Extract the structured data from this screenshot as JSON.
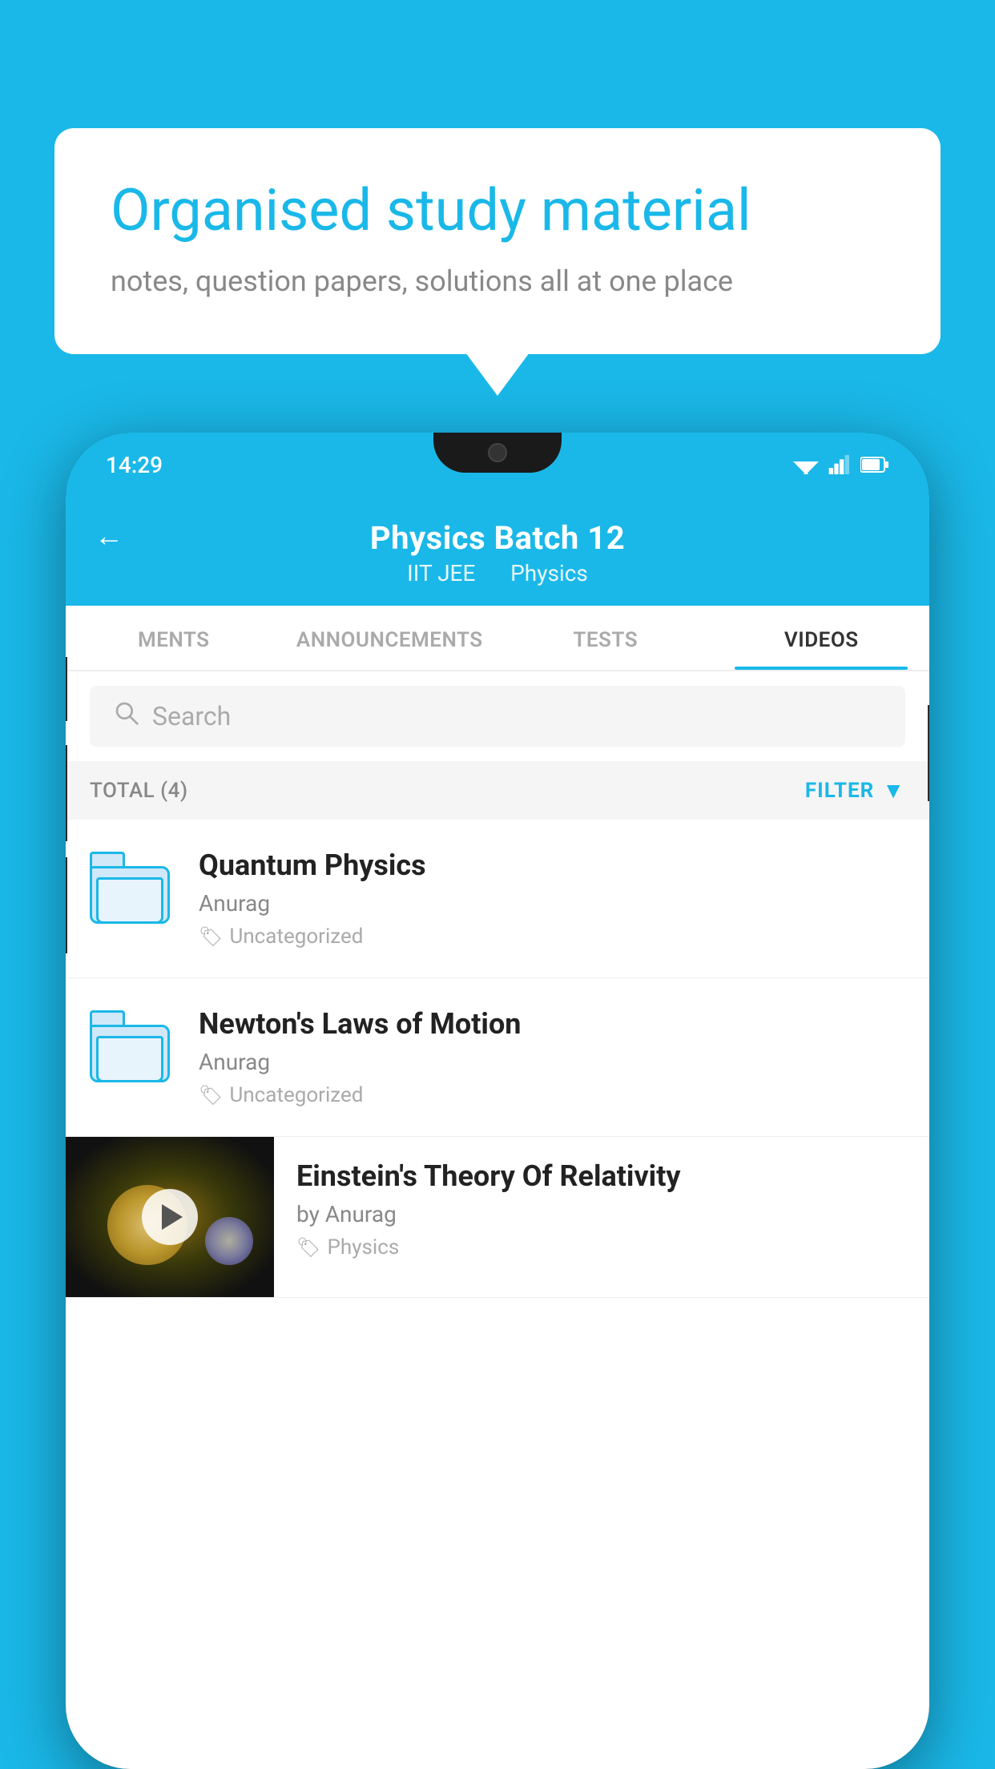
{
  "background_color": "#1ab8e8",
  "bubble": {
    "title": "Organised study material",
    "subtitle": "notes, question papers, solutions all at one place"
  },
  "phone": {
    "status_bar": {
      "time": "14:29"
    },
    "header": {
      "title": "Physics Batch 12",
      "tag1": "IIT JEE",
      "tag2": "Physics",
      "back_label": "←"
    },
    "tabs": [
      {
        "label": "MENTS",
        "active": false
      },
      {
        "label": "ANNOUNCEMENTS",
        "active": false
      },
      {
        "label": "TESTS",
        "active": false
      },
      {
        "label": "VIDEOS",
        "active": true
      }
    ],
    "search": {
      "placeholder": "Search"
    },
    "filter": {
      "total_label": "TOTAL (4)",
      "filter_label": "FILTER"
    },
    "videos": [
      {
        "title": "Quantum Physics",
        "author": "Anurag",
        "tag": "Uncategorized",
        "has_thumb": false
      },
      {
        "title": "Newton's Laws of Motion",
        "author": "Anurag",
        "tag": "Uncategorized",
        "has_thumb": false
      },
      {
        "title": "Einstein's Theory Of Relativity",
        "author": "by Anurag",
        "tag": "Physics",
        "has_thumb": true
      }
    ]
  }
}
